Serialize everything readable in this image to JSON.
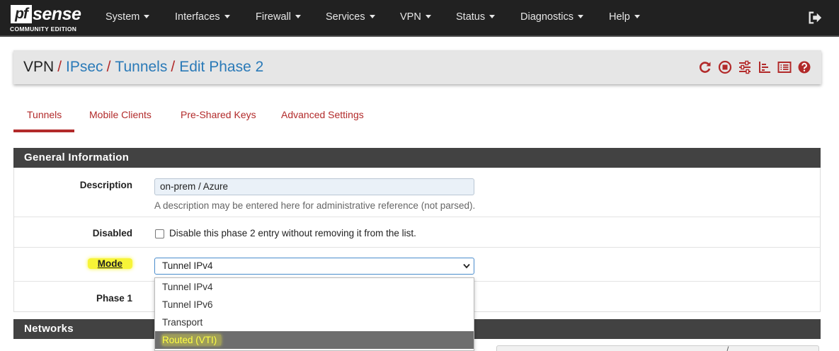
{
  "app": {
    "logo_text": "pfsense",
    "logo_pf": "pf",
    "logo_sense": "sense",
    "logo_subtitle": "COMMUNITY EDITION"
  },
  "nav": {
    "items": [
      {
        "label": "System"
      },
      {
        "label": "Interfaces"
      },
      {
        "label": "Firewall"
      },
      {
        "label": "Services"
      },
      {
        "label": "VPN"
      },
      {
        "label": "Status"
      },
      {
        "label": "Diagnostics"
      },
      {
        "label": "Help"
      }
    ],
    "logout_icon": "logout-icon"
  },
  "breadcrumb": {
    "root": "VPN",
    "items": [
      "IPsec",
      "Tunnels",
      "Edit Phase 2"
    ],
    "separator": "/"
  },
  "header_icons": [
    "reload-icon",
    "stop-circle-icon",
    "sliders-icon",
    "bar-chart-icon",
    "list-icon",
    "help-icon"
  ],
  "tabs": [
    {
      "label": "Tunnels",
      "active": true
    },
    {
      "label": "Mobile Clients",
      "active": false
    },
    {
      "label": "Pre-Shared Keys",
      "active": false
    },
    {
      "label": "Advanced Settings",
      "active": false
    }
  ],
  "general": {
    "title": "General Information",
    "description": {
      "label": "Description",
      "value": "on-prem / Azure",
      "help": "A description may be entered here for administrative reference (not parsed)."
    },
    "disabled": {
      "label": "Disabled",
      "checkbox_text": "Disable this phase 2 entry without removing it from the list.",
      "checked": false
    },
    "mode": {
      "label": "Mode",
      "selected": "Tunnel IPv4",
      "options": [
        "Tunnel IPv4",
        "Tunnel IPv6",
        "Transport",
        "Routed (VTI)"
      ],
      "highlighted_option": "Routed (VTI)"
    },
    "phase1": {
      "label": "Phase 1"
    }
  },
  "networks": {
    "title": "Networks",
    "subnet_separator": "/"
  },
  "colors": {
    "navbar": "#212121",
    "accent_red": "#b22a2a",
    "link_blue": "#2a7ab8",
    "panel_header": "#424242",
    "highlight_yellow": "#f7f437"
  }
}
